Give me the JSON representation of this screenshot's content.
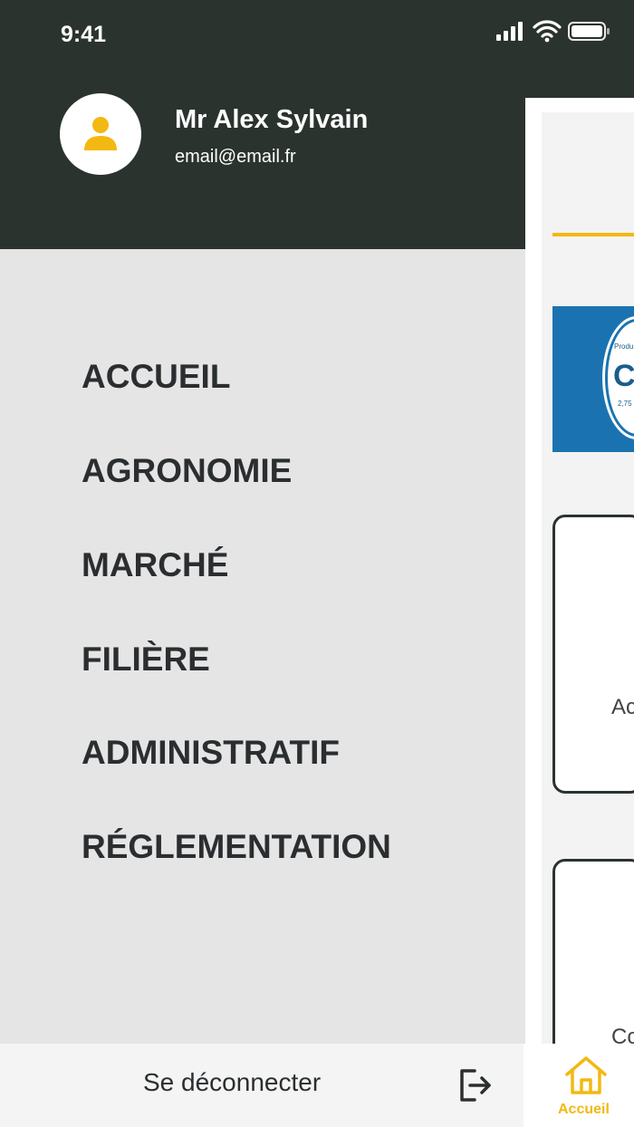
{
  "status_bar": {
    "time": "9:41"
  },
  "user": {
    "name": "Mr Alex Sylvain",
    "email": "email@email.fr"
  },
  "menu": {
    "items": [
      {
        "label": "ACCUEIL"
      },
      {
        "label": "AGRONOMIE"
      },
      {
        "label": "MARCHÉ"
      },
      {
        "label": "FILIÈRE"
      },
      {
        "label": "ADMINISTRATIF"
      },
      {
        "label": "RÉGLEMENTATION"
      }
    ]
  },
  "footer": {
    "logout_label": "Se déconnecter",
    "logout_icon": "logout-icon"
  },
  "background_page": {
    "banner_text": "CE",
    "banner_small_top": "Produ",
    "banner_small_bottom": "2,75",
    "card1_text": "Ac",
    "card2_text": "Co",
    "tab_home_label": "Accueil"
  },
  "colors": {
    "header_bg": "#2b332e",
    "menu_bg": "#e5e5e5",
    "accent": "#f3b811",
    "text_dark": "#2b2e30"
  }
}
